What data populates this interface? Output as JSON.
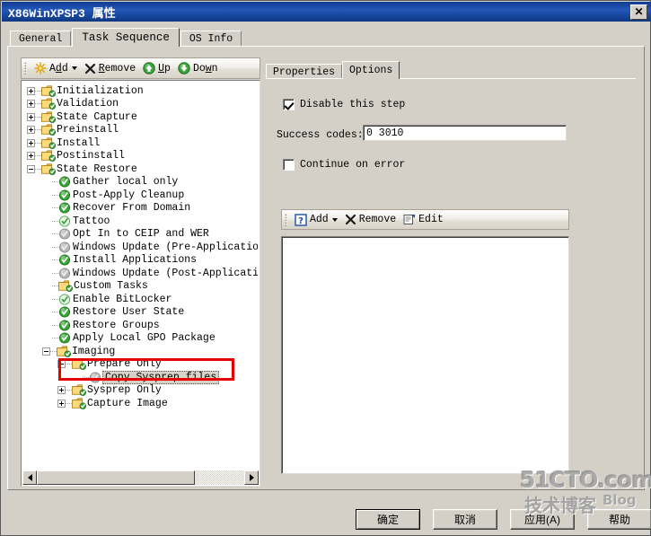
{
  "window": {
    "title": "X86WinXPSP3 属性",
    "close_label": "✕"
  },
  "tabs": [
    {
      "label": "General",
      "active": false
    },
    {
      "label": "Task Sequence",
      "active": true
    },
    {
      "label": "OS Info",
      "active": false
    }
  ],
  "left_toolbar": {
    "add": "Add",
    "remove": "Remove",
    "up": "Up",
    "down": "Down",
    "add_icon": "starburst-icon",
    "remove_icon": "x-icon",
    "up_icon": "green-up-arrow-icon",
    "down_icon": "green-down-arrow-icon",
    "dropdown_icon": "chevron-down-icon"
  },
  "tree": [
    {
      "label": "Initialization",
      "depth": 0,
      "icon": "folder",
      "expander": "plus"
    },
    {
      "label": "Validation",
      "depth": 0,
      "icon": "folder",
      "expander": "plus"
    },
    {
      "label": "State Capture",
      "depth": 0,
      "icon": "folder",
      "expander": "plus"
    },
    {
      "label": "Preinstall",
      "depth": 0,
      "icon": "folder",
      "expander": "plus"
    },
    {
      "label": "Install",
      "depth": 0,
      "icon": "folder",
      "expander": "plus"
    },
    {
      "label": "Postinstall",
      "depth": 0,
      "icon": "folder",
      "expander": "plus"
    },
    {
      "label": "State Restore",
      "depth": 0,
      "icon": "folder",
      "expander": "minus"
    },
    {
      "label": "Gather local only",
      "depth": 1,
      "icon": "check-green",
      "expander": "none"
    },
    {
      "label": "Post-Apply Cleanup",
      "depth": 1,
      "icon": "check-green",
      "expander": "none"
    },
    {
      "label": "Recover From Domain",
      "depth": 1,
      "icon": "check-green",
      "expander": "none"
    },
    {
      "label": "Tattoo",
      "depth": 1,
      "icon": "check-pale",
      "expander": "none"
    },
    {
      "label": "Opt In to CEIP and WER",
      "depth": 1,
      "icon": "check-gray",
      "expander": "none"
    },
    {
      "label": "Windows Update (Pre-Application I",
      "depth": 1,
      "icon": "check-gray",
      "expander": "none"
    },
    {
      "label": "Install Applications",
      "depth": 1,
      "icon": "check-green",
      "expander": "none"
    },
    {
      "label": "Windows Update (Post-Application",
      "depth": 1,
      "icon": "check-gray",
      "expander": "none"
    },
    {
      "label": "Custom Tasks",
      "depth": 1,
      "icon": "folder",
      "expander": "none"
    },
    {
      "label": "Enable BitLocker",
      "depth": 1,
      "icon": "check-pale",
      "expander": "none"
    },
    {
      "label": "Restore User State",
      "depth": 1,
      "icon": "check-green",
      "expander": "none"
    },
    {
      "label": "Restore Groups",
      "depth": 1,
      "icon": "check-green",
      "expander": "none"
    },
    {
      "label": "Apply Local GPO Package",
      "depth": 1,
      "icon": "check-green",
      "expander": "none"
    },
    {
      "label": "Imaging",
      "depth": 1,
      "icon": "folder",
      "expander": "minus"
    },
    {
      "label": "Prepare Only",
      "depth": 2,
      "icon": "folder",
      "expander": "minus"
    },
    {
      "label": "Copy Sysprep files",
      "depth": 3,
      "icon": "check-gray",
      "expander": "none",
      "selected": true
    },
    {
      "label": "Sysprep Only",
      "depth": 2,
      "icon": "folder",
      "expander": "plus"
    },
    {
      "label": "Capture Image",
      "depth": 2,
      "icon": "folder",
      "expander": "plus"
    }
  ],
  "inner_tabs": [
    {
      "label": "Properties",
      "active": false
    },
    {
      "label": "Options",
      "active": true
    }
  ],
  "options": {
    "disable_step_label": "Disable this step",
    "disable_step_checked": true,
    "success_codes_label": "Success codes:",
    "success_codes_value": "0 3010",
    "continue_on_error_label": "Continue on error",
    "continue_on_error_checked": false
  },
  "condition_toolbar": {
    "add": "Add",
    "remove": "Remove",
    "edit": "Edit",
    "add_icon": "question-mark-icon",
    "remove_icon": "x-icon",
    "edit_icon": "edit-document-icon",
    "dropdown_icon": "chevron-down-icon"
  },
  "condition_list": {
    "items": []
  },
  "footer_buttons": [
    {
      "label": "确定",
      "default": true
    },
    {
      "label": "取消",
      "default": false
    },
    {
      "label": "应用(A)",
      "default": false
    },
    {
      "label": "帮助",
      "default": false
    }
  ],
  "scrollbar": {
    "left_arrow": "left-arrow-icon",
    "right_arrow": "right-arrow-icon"
  },
  "watermark": {
    "line1": "51CTO.com",
    "line2": "技术博客",
    "line3": "Blog"
  },
  "colors": {
    "title_bar": "#1b4ba6",
    "dialog_face": "#d4d0c8",
    "highlight_box": "#e60000",
    "check_green": "#2aa12a",
    "check_gray": "#a8a8a8"
  }
}
